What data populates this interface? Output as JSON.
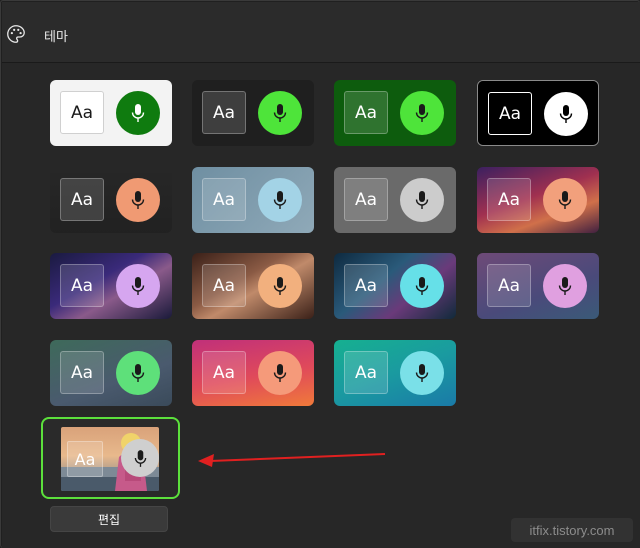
{
  "header": {
    "title": "테마",
    "icon": "palette-icon"
  },
  "tiles": [
    {
      "sample": "Aa",
      "background": "#f3f3f3",
      "mic_color": "#0f7b0f",
      "aa_background": "#ffffff",
      "aa_text_color": "#1a1a1a",
      "mic_icon_color": "#ffffff"
    },
    {
      "sample": "Aa",
      "background": "#1f1f1f",
      "mic_color": "#4ee43a",
      "aa_background": "#3a3a3a",
      "aa_text_color": "#ffffff",
      "mic_icon_color": "#1a1a1a"
    },
    {
      "sample": "Aa",
      "background": "#0d5c0d",
      "mic_color": "#4ee43a",
      "aa_background": "#2f7a2f",
      "aa_text_color": "#ffffff",
      "mic_icon_color": "#1a1a1a"
    },
    {
      "sample": "Aa",
      "background": "#000000",
      "mic_color": "#ffffff",
      "aa_background": "#000000",
      "aa_text_color": "#ffffff",
      "mic_icon_color": "#000000"
    },
    {
      "sample": "Aa",
      "background": "#b3452a",
      "mic_color": "#f09a73",
      "aa_background": "#c56a52",
      "aa_text_color": "#ffffff",
      "mic_icon_color": "#1a1a1a"
    },
    {
      "sample": "Aa",
      "background": "#7a97a8",
      "mic_color": "#a3d3e6",
      "aa_background": "#8fa9b8",
      "aa_text_color": "#ffffff",
      "mic_icon_color": "#1a1a1a"
    },
    {
      "sample": "Aa",
      "background": "#6a6a6a",
      "mic_color": "#cccccc",
      "aa_background": "#7d7d7d",
      "aa_text_color": "#ffffff",
      "mic_icon_color": "#1a1a1a"
    },
    {
      "sample": "Aa",
      "background": "#5a2a5a",
      "mic_color": "#f2a07c",
      "aa_background": "#8a4a6a",
      "aa_text_color": "#ffffff",
      "mic_icon_color": "#1a1a1a"
    },
    {
      "sample": "Aa",
      "background": "#2a2a5e",
      "mic_color": "#d6a6f0",
      "aa_background": "#4a4a7e",
      "aa_text_color": "#ffffff",
      "mic_icon_color": "#1a1a1a"
    },
    {
      "sample": "Aa",
      "background": "#6e3d28",
      "mic_color": "#f2b07e",
      "aa_background": "#8a5a44",
      "aa_text_color": "#ffffff",
      "mic_icon_color": "#1a1a1a"
    },
    {
      "sample": "Aa",
      "background": "#1e3a50",
      "mic_color": "#66e0e8",
      "aa_background": "#3a5a70",
      "aa_text_color": "#ffffff",
      "mic_icon_color": "#1a1a1a"
    },
    {
      "sample": "Aa",
      "background": "#5a4a78",
      "mic_color": "#e0a0e0",
      "aa_background": "#6e6090",
      "aa_text_color": "#ffffff",
      "mic_icon_color": "#1a1a1a"
    },
    {
      "sample": "Aa",
      "background": "#3e5a5a",
      "mic_color": "#5ee07a",
      "aa_background": "#557070",
      "aa_text_color": "#ffffff",
      "mic_icon_color": "#1a1a1a"
    },
    {
      "sample": "Aa",
      "background": "#d03a6a",
      "mic_color": "#f59a7a",
      "aa_background": "#e06a82",
      "aa_text_color": "#ffffff",
      "mic_icon_color": "#1a1a1a"
    },
    {
      "sample": "Aa",
      "background": "#1a9a8a",
      "mic_color": "#7ae0e8",
      "aa_background": "#3aaea0",
      "aa_text_color": "#ffffff",
      "mic_icon_color": "#1a1a1a"
    }
  ],
  "custom_theme": {
    "sample": "Aa",
    "selected": true,
    "accent_color": "#5ce03c",
    "mic_icon": "microphone-icon"
  },
  "edit_button": {
    "label": "편집"
  },
  "watermark": {
    "text": "itfix.tistory.com"
  },
  "annotation": {
    "arrow_color": "#e02020"
  }
}
